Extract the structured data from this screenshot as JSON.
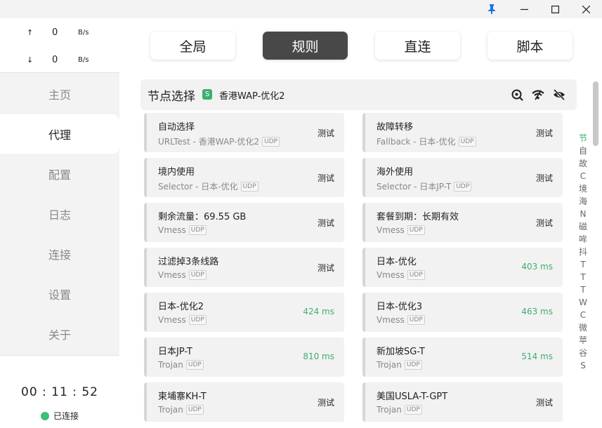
{
  "window": {
    "pin_icon": "pin-icon",
    "minimize_label": "—",
    "maximize_label": "☐",
    "close_label": "✕"
  },
  "traffic": {
    "up": {
      "arrow": "↑",
      "value": "0",
      "unit": "B/s"
    },
    "down": {
      "arrow": "↓",
      "value": "0",
      "unit": "B/s"
    }
  },
  "nav": {
    "items": [
      {
        "label": "主页"
      },
      {
        "label": "代理"
      },
      {
        "label": "配置"
      },
      {
        "label": "日志"
      },
      {
        "label": "连接"
      },
      {
        "label": "设置"
      },
      {
        "label": "关于"
      }
    ],
    "active": "代理"
  },
  "footer": {
    "timer": "00 : 11 : 52",
    "status": "已连接",
    "status_color": "#3fbe7b"
  },
  "modes": {
    "items": [
      {
        "label": "全局"
      },
      {
        "label": "规则"
      },
      {
        "label": "直连"
      },
      {
        "label": "脚本"
      }
    ],
    "active": "规则"
  },
  "group": {
    "title": "节点选择",
    "badge": "S",
    "current": "香港WAP-优化2",
    "icons": [
      "search-icon",
      "wifi-icon",
      "eye-off-icon"
    ]
  },
  "proxies": [
    {
      "name": "自动选择",
      "type": "URLTest - 香港WAP-优化2",
      "udp": "UDP",
      "action": "测试",
      "delay": ""
    },
    {
      "name": "故障转移",
      "type": "Fallback - 日本-优化",
      "udp": "UDP",
      "action": "测试",
      "delay": ""
    },
    {
      "name": "境内使用",
      "type": "Selector - 日本-优化",
      "udp": "UDP",
      "action": "测试",
      "delay": ""
    },
    {
      "name": "海外使用",
      "type": "Selector - 日本JP-T",
      "udp": "UDP",
      "action": "测试",
      "delay": ""
    },
    {
      "name": "剩余流量：69.55 GB",
      "type": "Vmess",
      "udp": "UDP",
      "action": "测试",
      "delay": ""
    },
    {
      "name": "套餐到期：长期有效",
      "type": "Vmess",
      "udp": "UDP",
      "action": "测试",
      "delay": ""
    },
    {
      "name": "过滤掉3条线路",
      "type": "Vmess",
      "udp": "UDP",
      "action": "测试",
      "delay": ""
    },
    {
      "name": "日本-优化",
      "type": "Vmess",
      "udp": "UDP",
      "action": "",
      "delay": "403 ms"
    },
    {
      "name": "日本-优化2",
      "type": "Vmess",
      "udp": "UDP",
      "action": "",
      "delay": "424 ms"
    },
    {
      "name": "日本-优化3",
      "type": "Vmess",
      "udp": "UDP",
      "action": "",
      "delay": "463 ms"
    },
    {
      "name": "日本JP-T",
      "type": "Trojan",
      "udp": "UDP",
      "action": "",
      "delay": "810 ms"
    },
    {
      "name": "新加坡SG-T",
      "type": "Trojan",
      "udp": "UDP",
      "action": "",
      "delay": "514 ms"
    },
    {
      "name": "柬埔寨KH-T",
      "type": "Trojan",
      "udp": "UDP",
      "action": "测试",
      "delay": ""
    },
    {
      "name": "美国USLA-T-GPT",
      "type": "Trojan",
      "udp": "UDP",
      "action": "测试",
      "delay": ""
    }
  ],
  "alpha_index": [
    "节",
    "自",
    "故",
    "C",
    "境",
    "海",
    "N",
    "磁",
    "哞",
    "抖",
    "T",
    "T",
    "T",
    "W",
    "C",
    "微",
    "苹",
    "谷",
    "S"
  ],
  "colors": {
    "accent": "#3fae6e",
    "active_mode": "#484848"
  }
}
